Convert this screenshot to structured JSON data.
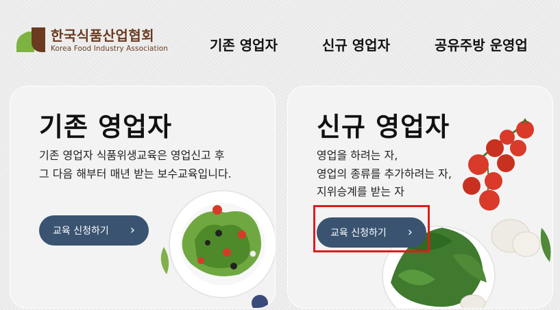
{
  "logo": {
    "name_ko": "한국식품산업협회",
    "name_en": "Korea Food Industry Association"
  },
  "nav": [
    {
      "label": "기존 영업자"
    },
    {
      "label": "신규 영업자"
    },
    {
      "label": "공유주방 운영업"
    }
  ],
  "cards": [
    {
      "title": "기존 영업자",
      "desc_lines": [
        "기존 영업자 식품위생교육은 영업신고 후",
        "그 다음 해부터 매년 받는 보수교육입니다."
      ],
      "button": "교육 신청하기"
    },
    {
      "title": "신규 영업자",
      "desc_lines": [
        "영업을 하려는 자,",
        "영업의 종류를 추가하려는 자,",
        "지위승계를 받는 자"
      ],
      "button": "교육 신청하기"
    }
  ],
  "colors": {
    "brand_brown": "#6b3a1f",
    "brand_green": "#7cb342",
    "button_bg": "#3a5371",
    "highlight": "#e01b1b"
  },
  "icons": {
    "button_arrow": "chevron-right-icon"
  }
}
